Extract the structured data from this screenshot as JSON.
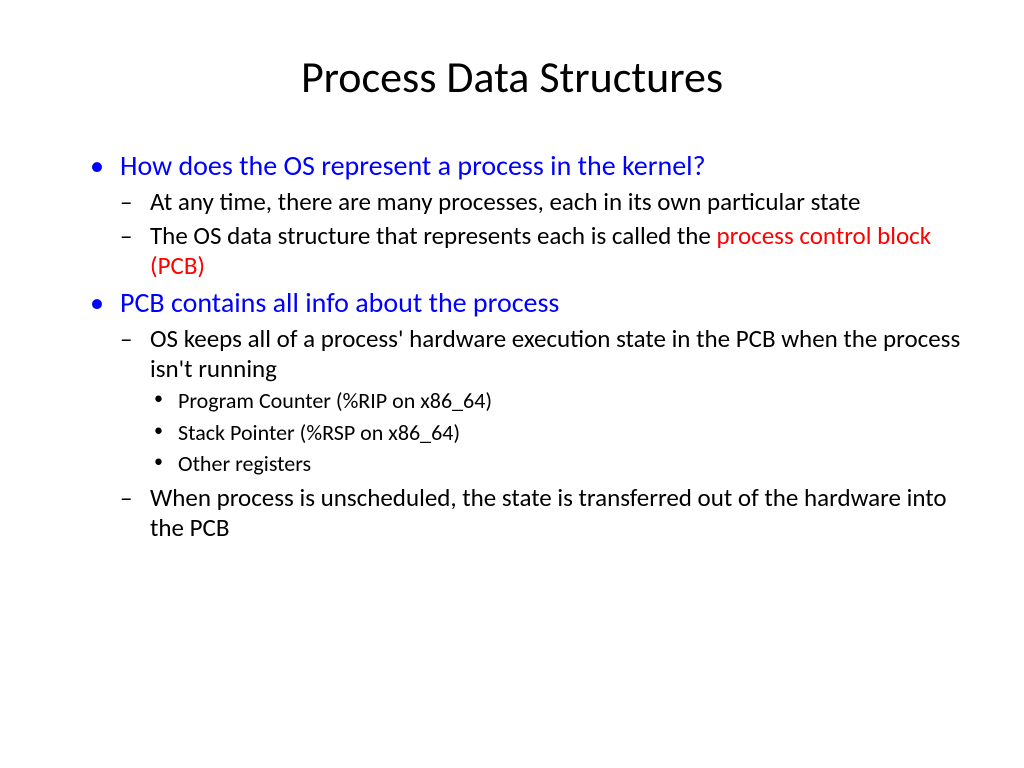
{
  "title": "Process Data Structures",
  "bullets": {
    "b1": {
      "text": "How does the OS represent a process in the kernel?",
      "sub1": "At any time, there are many processes, each in its own particular state",
      "sub2_prefix": "The OS data structure that represents each is called the ",
      "sub2_red": "process control block (PCB)"
    },
    "b2": {
      "text": "PCB contains all info about the process",
      "sub1": "OS keeps all of a process' hardware execution state in the PCB when the process isn't running",
      "sub1_items": {
        "i1": "Program Counter (%RIP on x86_64)",
        "i2": "Stack Pointer (%RSP on x86_64)",
        "i3": "Other registers"
      },
      "sub2": "When process is unscheduled, the state is transferred out of the hardware into the PCB"
    }
  }
}
